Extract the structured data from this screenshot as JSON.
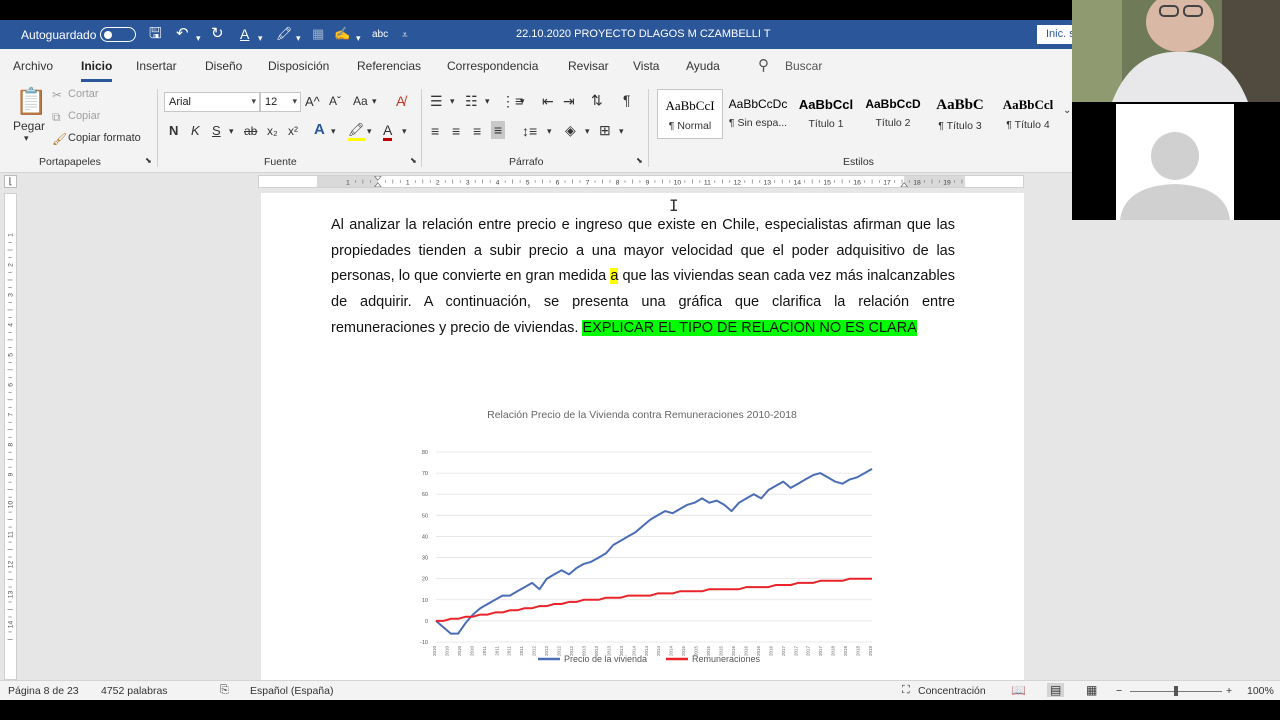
{
  "titlebar": {
    "autosave_label": "Autoguardado",
    "document_title": "22.10.2020 PROYECTO DLAGOS M CZAMBELLI T",
    "signin_label": "Inic. s"
  },
  "tabs": [
    "Archivo",
    "Inicio",
    "Insertar",
    "Diseño",
    "Disposición",
    "Referencias",
    "Correspondencia",
    "Revisar",
    "Vista",
    "Ayuda"
  ],
  "search": {
    "label": "Buscar"
  },
  "clipboard": {
    "paste": "Pegar",
    "cut": "Cortar",
    "copy": "Copiar",
    "format_painter": "Copiar formato",
    "group_label": "Portapapeles"
  },
  "font": {
    "family": "Arial",
    "size": "12",
    "group_label": "Fuente",
    "bold": "N",
    "italic": "K",
    "underline": "S",
    "strike": "ab",
    "subscript": "x₂",
    "superscript": "x²",
    "grow": "A^",
    "shrink": "Aˇ",
    "case": "Aa"
  },
  "paragraph": {
    "group_label": "Párrafo"
  },
  "styles": {
    "group_label": "Estilos",
    "items": [
      {
        "preview": "AaBbCcI",
        "name": "¶ Normal"
      },
      {
        "preview": "AaBbCcDc",
        "name": "¶ Sin espa..."
      },
      {
        "preview": "AaBbCcl",
        "name": "Título 1"
      },
      {
        "preview": "AaBbCcD",
        "name": "Título 2"
      },
      {
        "preview": "AaBbC",
        "name": "¶ Título 3"
      },
      {
        "preview": "AaBbCcl",
        "name": "¶ Título 4"
      }
    ]
  },
  "document": {
    "paragraph_before": "Al analizar la relación entre precio e ingreso que existe en Chile, especialistas afirman que las propiedades tienden a subir precio a una mayor velocidad que el poder adquisitivo de las personas, lo que convierte en gran medida ",
    "highlight_a": "a",
    "paragraph_middle": " que las viviendas sean cada vez más inalcanzables de adquirir.  A continuación, se presenta una gráfica que clarifica la relación entre remuneraciones y precio de viviendas. ",
    "highlight_note": "EXPLICAR EL TIPO DE RELACION NO ES CLARA"
  },
  "chart_data": {
    "type": "line",
    "title": "Relación  Precio de la Vivienda  contra  Remuneraciones  2010-2018",
    "ylim": [
      -10,
      80
    ],
    "yticks": [
      -10,
      0,
      10,
      20,
      30,
      40,
      50,
      60,
      70,
      80
    ],
    "xlabels": [
      "2010",
      "2010",
      "2010",
      "2010",
      "2011",
      "2011",
      "2011",
      "2011",
      "2012",
      "2012",
      "2012",
      "2012",
      "2013",
      "2013",
      "2013",
      "2013",
      "2014",
      "2014",
      "2014",
      "2014",
      "2015",
      "2015",
      "2015",
      "2015",
      "2016",
      "2016",
      "2016",
      "2016",
      "2017",
      "2017",
      "2017",
      "2017",
      "2018",
      "2018",
      "2018",
      "2018"
    ],
    "grid": true,
    "legend_position": "bottom",
    "series": [
      {
        "name": "Precio de la vivienda",
        "color": "#4a6db5",
        "values": [
          0,
          -3,
          -6,
          -6,
          -1,
          3,
          6,
          8,
          10,
          12,
          12,
          14,
          16,
          18,
          15,
          20,
          22,
          24,
          22,
          25,
          27,
          28,
          30,
          32,
          36,
          38,
          40,
          42,
          45,
          48,
          50,
          52,
          51,
          53,
          55,
          56,
          58,
          56,
          57,
          55,
          52,
          56,
          58,
          60,
          58,
          62,
          64,
          66,
          63,
          65,
          67,
          69,
          70,
          68,
          66,
          65,
          67,
          68,
          70,
          72
        ]
      },
      {
        "name": "Remuneraciones",
        "color": "#e8232a",
        "values": [
          0,
          0,
          1,
          1,
          2,
          2,
          3,
          3,
          4,
          4,
          5,
          5,
          6,
          6,
          7,
          7,
          8,
          8,
          9,
          9,
          10,
          10,
          10,
          11,
          11,
          11,
          12,
          12,
          12,
          12,
          13,
          13,
          13,
          14,
          14,
          14,
          14,
          15,
          15,
          15,
          15,
          15,
          16,
          16,
          16,
          16,
          17,
          17,
          17,
          18,
          18,
          18,
          19,
          19,
          19,
          19,
          20,
          20,
          20,
          20
        ]
      }
    ]
  },
  "statusbar": {
    "page": "Página 8 de 23",
    "words": "4752 palabras",
    "language": "Español (España)",
    "focus": "Concentración",
    "zoom": "100%"
  }
}
